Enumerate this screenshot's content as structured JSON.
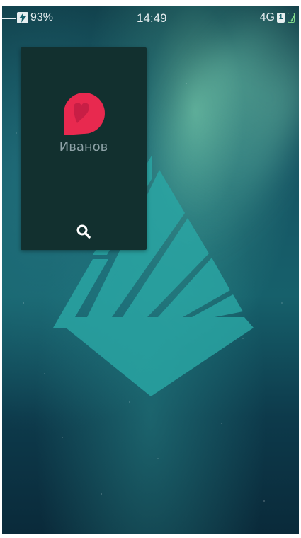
{
  "status_bar": {
    "battery_percent": "93%",
    "time": "14:49",
    "network": "4G",
    "sim_slot": "1",
    "icons": {
      "charging": "charging-bolt-icon",
      "sim": "sim-card-icon",
      "signal": "signal-icon"
    }
  },
  "app_card": {
    "name": "Иванов",
    "icon": "heart-bubble-icon",
    "action_icon": "search-icon",
    "colors": {
      "card_background": "#12302f",
      "icon_primary": "#e8294f",
      "icon_shadow": "#c81e45"
    }
  },
  "wallpaper": {
    "logo": "sailfish-triangle-logo",
    "colors": {
      "logo": "#2aa7a5",
      "sky_top": "#0f3a45",
      "sky_bottom": "#0a2a3a"
    }
  }
}
